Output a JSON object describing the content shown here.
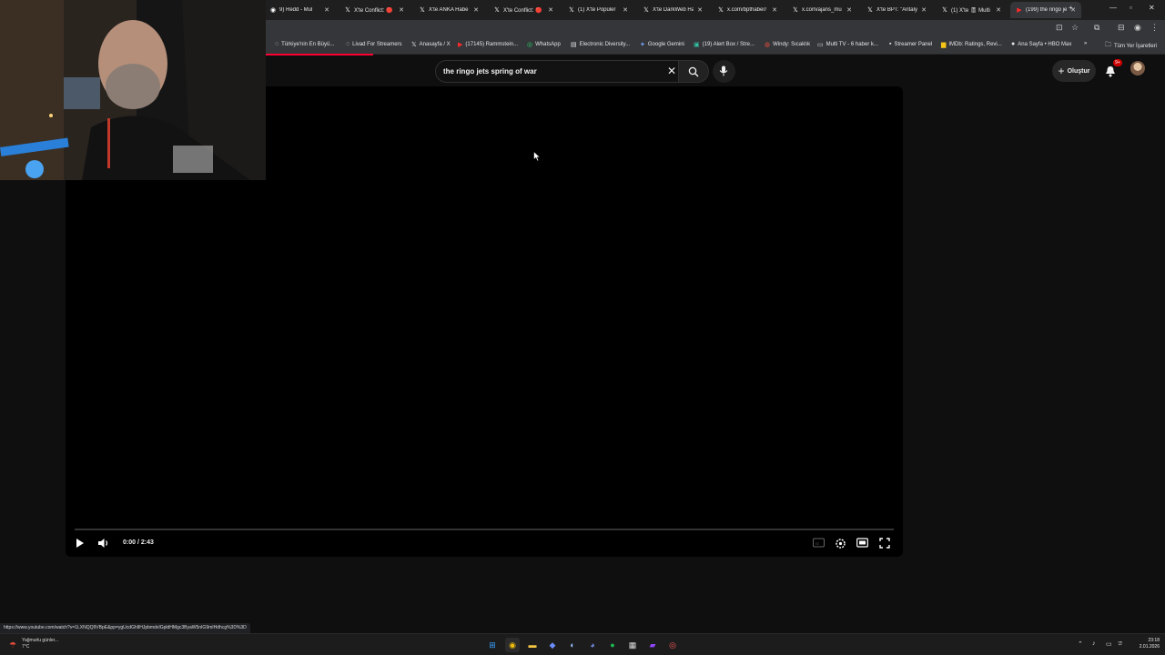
{
  "browser": {
    "tabs": [
      {
        "title": "9) Redd - Mul",
        "icon": "reddit-icon"
      },
      {
        "title": "X'te Conflict: 🔴",
        "icon": "x-icon"
      },
      {
        "title": "X'te ANKA Habe",
        "icon": "x-icon"
      },
      {
        "title": "X'te Conflict: 🔴",
        "icon": "x-icon"
      },
      {
        "title": "(1) X'te Popüler",
        "icon": "x-icon"
      },
      {
        "title": "X'te DarkWeb Ha",
        "icon": "x-icon"
      },
      {
        "title": "x.com/bpthaber/",
        "icon": "x-icon"
      },
      {
        "title": "x.com/ajans_mu",
        "icon": "x-icon"
      },
      {
        "title": "X'te BPT: \"Antaly",
        "icon": "x-icon"
      },
      {
        "title": "(1) X'te 🎚 Multi",
        "icon": "x-icon"
      },
      {
        "title": "(199) the ringo je",
        "icon": "youtube-icon",
        "active": true
      }
    ],
    "new_tab_glyph": "+",
    "bookmarks": [
      {
        "label": "Türkiye'nin En Büyü...",
        "icon": "globe-icon"
      },
      {
        "label": "Livad For Streamers",
        "icon": "globe-icon"
      },
      {
        "label": "Anasayfa / X",
        "icon": "x-icon"
      },
      {
        "label": "(17145) Rammstein...",
        "icon": "youtube-icon"
      },
      {
        "label": "WhatsApp",
        "icon": "whatsapp-icon"
      },
      {
        "label": "Electronic Diversity...",
        "icon": "doc-icon"
      },
      {
        "label": "Google Gemini",
        "icon": "gemini-icon"
      },
      {
        "label": "(19) Alert Box / Stre...",
        "icon": "streamlabs-icon"
      },
      {
        "label": "Windy: Sıcaklık",
        "icon": "windy-icon"
      },
      {
        "label": "Multi TV - 6 haber k...",
        "icon": "tv-icon"
      },
      {
        "label": "Streamer Panel",
        "icon": "panel-icon"
      },
      {
        "label": "IMDb: Ratings, Revi...",
        "icon": "imdb-icon"
      },
      {
        "label": "Ana Sayfa • HBO Max",
        "icon": "hbo-icon"
      }
    ],
    "bookmarks_overflow": "»",
    "all_bookmarks": "Tüm Yer İşaretleri",
    "status_url": "https://www.youtube.com/watch?v=1LXNQQ9VBpE&pp=ygUcdGhlIHJpbmdvIGpldHMgc3ByaW5nIG9mIHdhcg%3D%3D"
  },
  "youtube": {
    "search_query": "the ringo jets spring of war",
    "create_label": "Oluştur",
    "notifications_count": "9+",
    "player": {
      "current_time": "0:00",
      "duration": "2:43",
      "time_sep": " / ",
      "progress": 0
    }
  },
  "taskbar": {
    "weather": "Yağmurlu günler...",
    "temperature": "7°C",
    "time": "23:18",
    "date": "2.01.2026"
  },
  "colors": {
    "yt_red": "#ff0033",
    "bg": "#0f0f0f",
    "player": "#000000"
  }
}
